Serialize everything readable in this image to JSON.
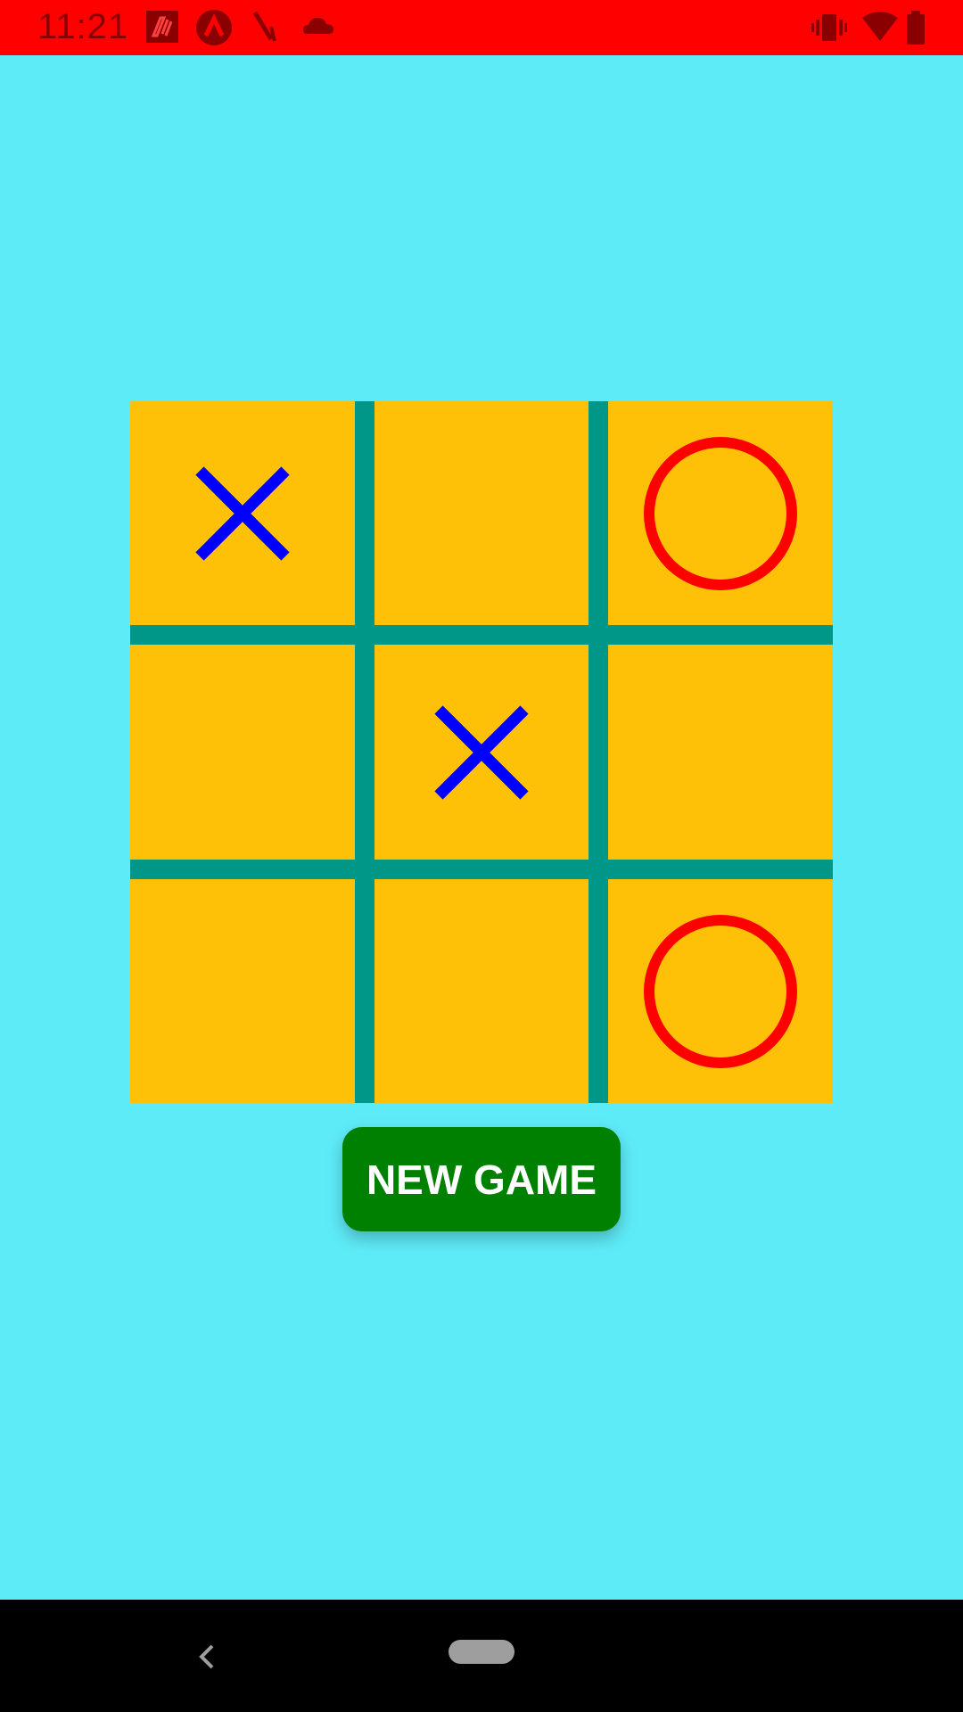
{
  "status_bar": {
    "time": "11:21",
    "left_icons": [
      "notification-app-icon",
      "arch-icon",
      "pen-icon",
      "cloud-icon"
    ],
    "right_icons": [
      "vibrate-icon",
      "wifi-icon",
      "battery-icon"
    ],
    "color": "#FF0000"
  },
  "board": {
    "rows": 3,
    "cols": 3,
    "cells": [
      [
        "X",
        "",
        "O"
      ],
      [
        "",
        "X",
        ""
      ],
      [
        "",
        "",
        "O"
      ]
    ],
    "cell_color": "#FFC107",
    "grid_color": "#009688",
    "x_color": "#0000FF",
    "o_color": "#FF0000"
  },
  "new_game_button": {
    "label": "NEW GAME",
    "color": "#008000"
  },
  "nav_bar": {
    "back_icon": "back-icon",
    "home_icon": "home-pill-icon"
  },
  "background_color": "#5EEBF8"
}
